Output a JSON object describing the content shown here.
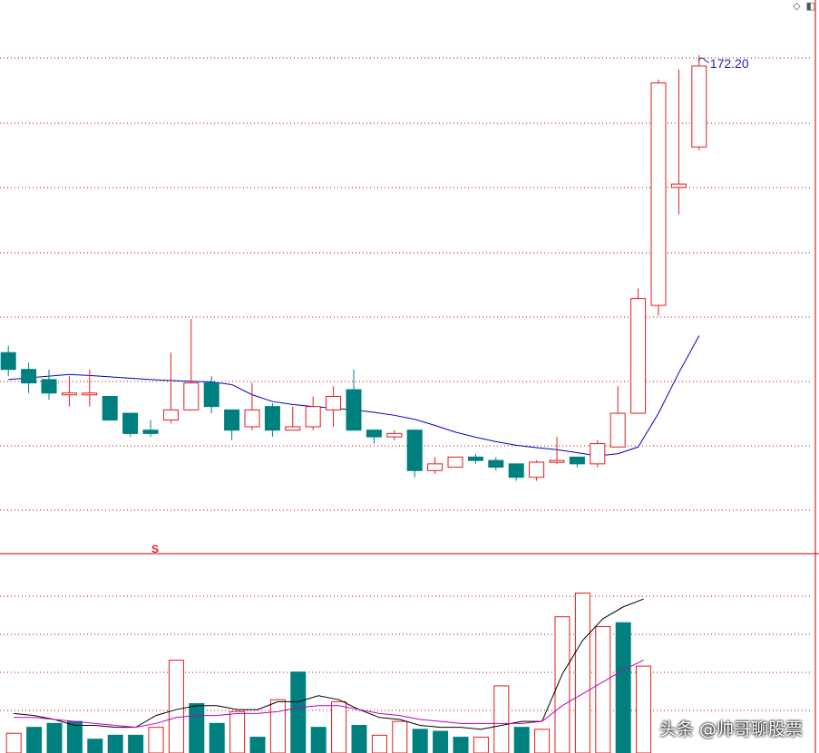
{
  "chart_data": {
    "type": "candlestick",
    "price_panel": {
      "max_label": "172.20",
      "signal_marker": "S",
      "candles": [
        {
          "o": 84.0,
          "h": 86.0,
          "l": 77.0,
          "c": 79.0
        },
        {
          "o": 79.0,
          "h": 81.0,
          "l": 72.0,
          "c": 75.0
        },
        {
          "o": 76.0,
          "h": 79.0,
          "l": 70.0,
          "c": 72.0
        },
        {
          "o": 72.0,
          "h": 77.0,
          "l": 68.0,
          "c": 72.0
        },
        {
          "o": 72.0,
          "h": 79.0,
          "l": 68.0,
          "c": 72.0
        },
        {
          "o": 71.0,
          "h": 71.0,
          "l": 64.0,
          "c": 64.0
        },
        {
          "o": 66.0,
          "h": 66.0,
          "l": 59.0,
          "c": 60.0
        },
        {
          "o": 61.0,
          "h": 64.0,
          "l": 59.0,
          "c": 60.0
        },
        {
          "o": 64.0,
          "h": 84.0,
          "l": 63.0,
          "c": 67.0
        },
        {
          "o": 67.0,
          "h": 94.0,
          "l": 67.0,
          "c": 75.0
        },
        {
          "o": 75.0,
          "h": 77.0,
          "l": 66.0,
          "c": 68.0
        },
        {
          "o": 67.0,
          "h": 67.0,
          "l": 58.0,
          "c": 61.0
        },
        {
          "o": 62.0,
          "h": 75.0,
          "l": 61.0,
          "c": 67.0
        },
        {
          "o": 68.0,
          "h": 69.0,
          "l": 59.0,
          "c": 61.0
        },
        {
          "o": 61.0,
          "h": 68.0,
          "l": 61.0,
          "c": 62.0
        },
        {
          "o": 62.0,
          "h": 71.0,
          "l": 61.0,
          "c": 68.0
        },
        {
          "o": 67.0,
          "h": 74.0,
          "l": 62.0,
          "c": 71.0
        },
        {
          "o": 73.0,
          "h": 79.0,
          "l": 61.0,
          "c": 61.0
        },
        {
          "o": 61.0,
          "h": 61.0,
          "l": 57.0,
          "c": 59.0
        },
        {
          "o": 59.0,
          "h": 61.0,
          "l": 58.0,
          "c": 60.0
        },
        {
          "o": 61.0,
          "h": 61.0,
          "l": 47.0,
          "c": 49.0
        },
        {
          "o": 49.0,
          "h": 53.0,
          "l": 48.0,
          "c": 51.0
        },
        {
          "o": 50.0,
          "h": 53.0,
          "l": 50.0,
          "c": 53.0
        },
        {
          "o": 53.0,
          "h": 54.0,
          "l": 51.0,
          "c": 52.0
        },
        {
          "o": 52.0,
          "h": 53.0,
          "l": 49.0,
          "c": 50.0
        },
        {
          "o": 51.0,
          "h": 51.0,
          "l": 46.0,
          "c": 47.0
        },
        {
          "o": 47.0,
          "h": 52.0,
          "l": 46.0,
          "c": 51.5
        },
        {
          "o": 51.5,
          "h": 59.0,
          "l": 51.0,
          "c": 52.0
        },
        {
          "o": 53.0,
          "h": 53.0,
          "l": 50.0,
          "c": 51.0
        },
        {
          "o": 51.0,
          "h": 58.0,
          "l": 50.0,
          "c": 57.0
        },
        {
          "o": 56.0,
          "h": 74.0,
          "l": 56.0,
          "c": 66.0
        },
        {
          "o": 66.0,
          "h": 103.0,
          "l": 66.0,
          "c": 100.0
        },
        {
          "o": 98.0,
          "h": 165.0,
          "l": 95.0,
          "c": 164.0
        },
        {
          "o": 133.0,
          "h": 168.0,
          "l": 125.0,
          "c": 134.0
        },
        {
          "o": 145.0,
          "h": 172.2,
          "l": 144.0,
          "c": 169.0
        }
      ],
      "ma": [
        76,
        76.5,
        77,
        77.5,
        77.2,
        76.8,
        76.4,
        76.0,
        75.7,
        75.5,
        75.3,
        74.5,
        71.5,
        69.5,
        68.6,
        68.0,
        67.5,
        67.0,
        66.3,
        65.4,
        64.2,
        62.4,
        60.4,
        58.9,
        57.6,
        56.5,
        55.8,
        55.2,
        54.3,
        53.4,
        54.0,
        56.0,
        66.0,
        78.0,
        89.0
      ]
    },
    "volume_panel": {
      "volumes": [
        10,
        13,
        15,
        16,
        7,
        9,
        9,
        13,
        47,
        25,
        15,
        21,
        8,
        27,
        41,
        13,
        26,
        14,
        9,
        16,
        12,
        11,
        8,
        8,
        34,
        13,
        12,
        69,
        81,
        64,
        66,
        44
      ],
      "up": [
        true,
        false,
        false,
        false,
        false,
        false,
        false,
        true,
        true,
        false,
        false,
        true,
        false,
        true,
        false,
        false,
        true,
        false,
        true,
        true,
        false,
        false,
        false,
        true,
        true,
        false,
        true,
        true,
        true,
        true,
        false,
        true
      ],
      "ma_short": [
        20,
        19,
        17,
        14,
        14,
        13,
        13,
        19,
        22,
        24,
        24,
        22,
        22,
        26,
        26,
        29,
        27,
        22,
        18,
        17,
        14,
        13,
        13,
        12,
        14,
        16,
        16,
        40,
        57,
        68,
        74,
        78
      ],
      "ma_long": [
        18,
        18,
        17,
        16,
        15,
        14,
        13,
        15,
        18,
        19,
        19,
        20,
        20,
        21,
        23,
        24,
        24,
        22,
        20,
        19,
        17,
        16,
        15,
        15,
        15,
        15,
        16,
        24,
        30,
        36,
        42,
        47
      ],
      "ymax": 95
    },
    "colors": {
      "up": "#e21d1d",
      "down": "#007f7f",
      "ma_price": "#0000c0",
      "vol_ma_short": "#000000",
      "vol_ma_long": "#c000c0",
      "grid": "#c00000"
    }
  },
  "watermark": "头条 @帅哥聊股票",
  "corner_icons": [
    "diamond-icon",
    "panel-icon"
  ]
}
